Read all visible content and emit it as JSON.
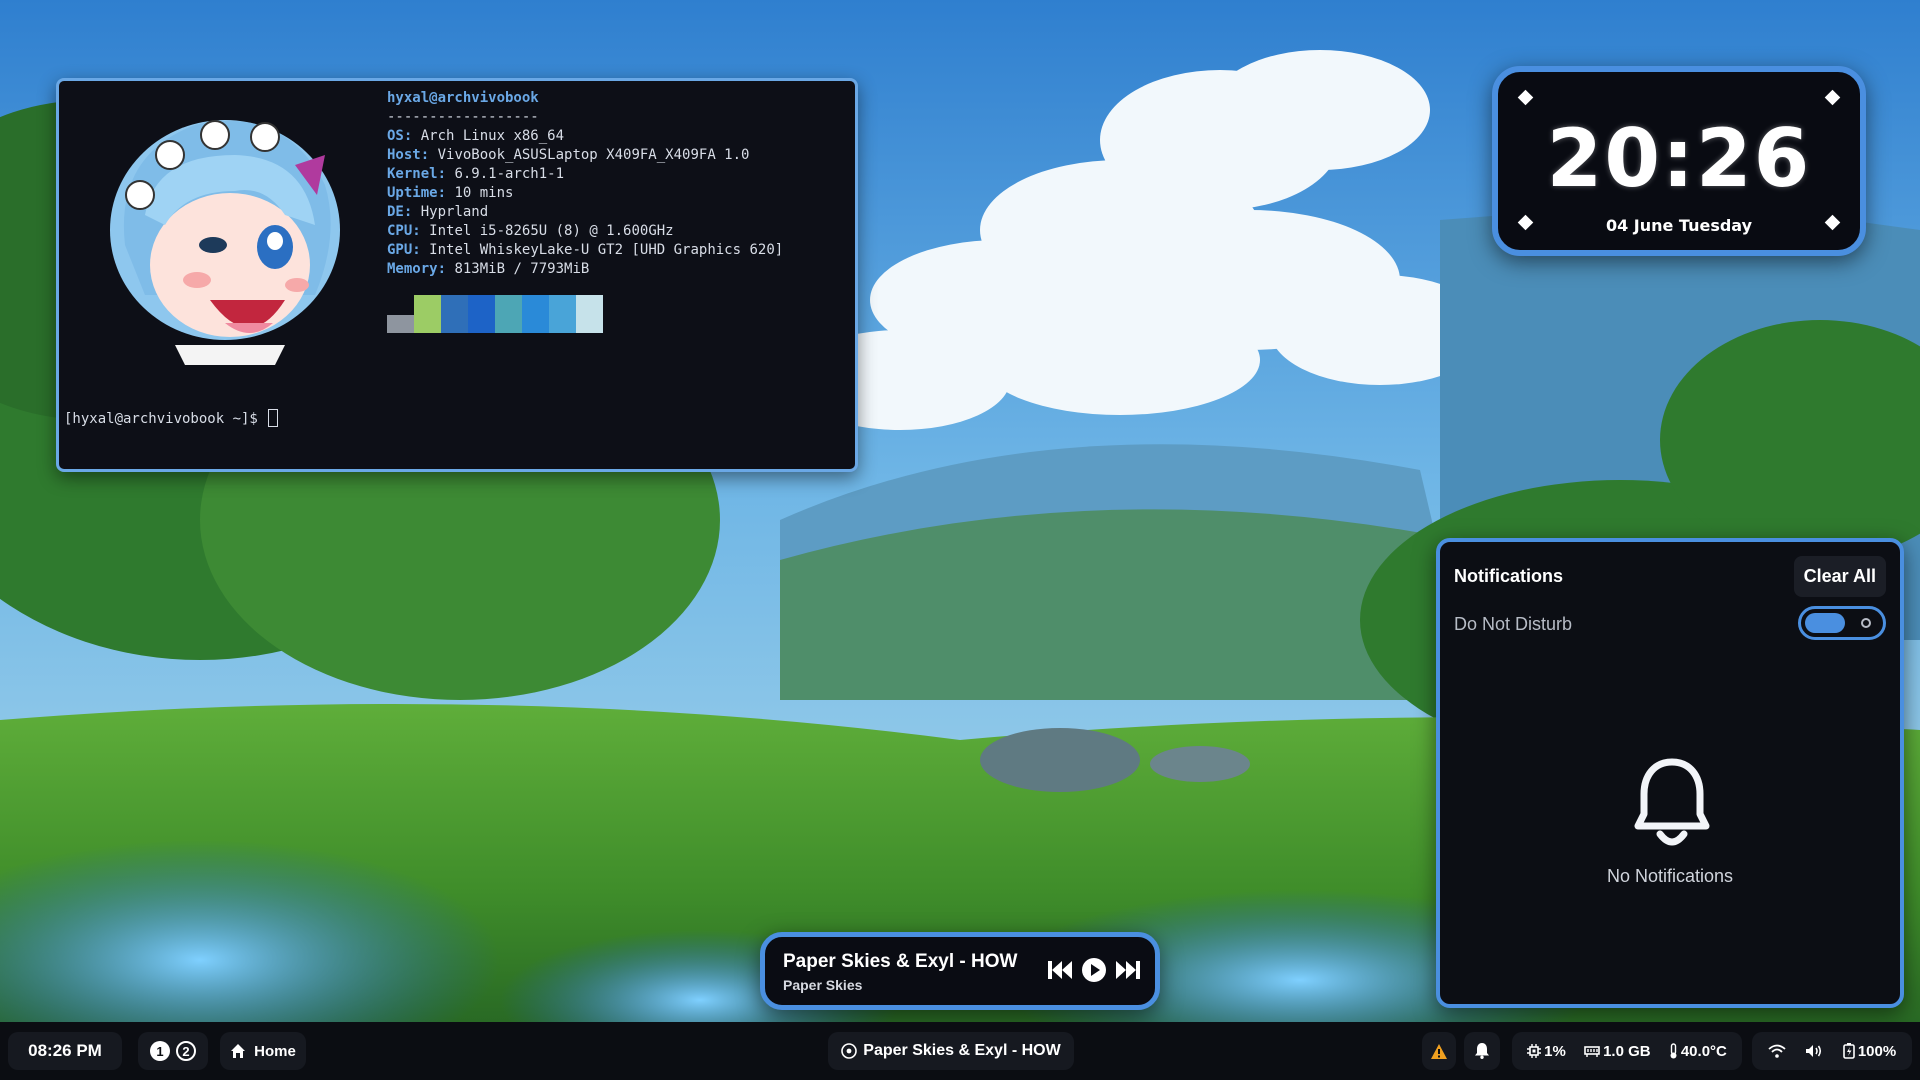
{
  "terminal": {
    "user_host": "hyxal@archvivobook",
    "separator": "------------------",
    "info": [
      {
        "key": "OS",
        "value": "Arch Linux x86_64"
      },
      {
        "key": "Host",
        "value": "VivoBook_ASUSLaptop X409FA_X409FA 1.0"
      },
      {
        "key": "Kernel",
        "value": "6.9.1-arch1-1"
      },
      {
        "key": "Uptime",
        "value": "10 mins"
      },
      {
        "key": "DE",
        "value": "Hyprland"
      },
      {
        "key": "CPU",
        "value": "Intel i5-8265U (8) @ 1.600GHz"
      },
      {
        "key": "GPU",
        "value": "Intel WhiskeyLake-U GT2 [UHD Graphics 620]"
      },
      {
        "key": "Memory",
        "value": "813MiB / 7793MiB"
      }
    ],
    "palette": [
      "#8e959f",
      "#9ccc65",
      "#2f6fb8",
      "#1d63c7",
      "#4da6b5",
      "#2a8ad8",
      "#49a4d8",
      "#c6e2ea"
    ],
    "prompt": "[hyxal@archvivobook ~]$ "
  },
  "clock_widget": {
    "time": "20:26",
    "date": "04 June Tuesday"
  },
  "notifications": {
    "title": "Notifications",
    "clear_label": "Clear All",
    "dnd_label": "Do Not Disturb",
    "dnd_enabled": true,
    "empty_text": "No Notifications"
  },
  "player": {
    "track": "Paper Skies & Exyl - HOW",
    "artist": "Paper Skies"
  },
  "bar": {
    "clock": "08:26 PM",
    "workspaces": [
      {
        "label": "1",
        "active": true
      },
      {
        "label": "2",
        "active": false
      }
    ],
    "home_label": "Home",
    "now_playing": "Paper Skies & Exyl - HOW",
    "cpu": "1%",
    "memory": "1.0 GB",
    "temperature": "40.0°C",
    "battery": "100%"
  },
  "colors": {
    "accent": "#4a8fe0",
    "terminal_accent": "#6aa8e6",
    "panel_bg": "#0c0e14",
    "warning": "#f0a020"
  },
  "icons": [
    "home-icon",
    "music-icon",
    "warning-icon",
    "bell-icon",
    "cpu-icon",
    "memory-icon",
    "thermometer-icon",
    "wifi-icon",
    "volume-icon",
    "battery-icon",
    "previous-icon",
    "play-icon",
    "next-icon"
  ]
}
